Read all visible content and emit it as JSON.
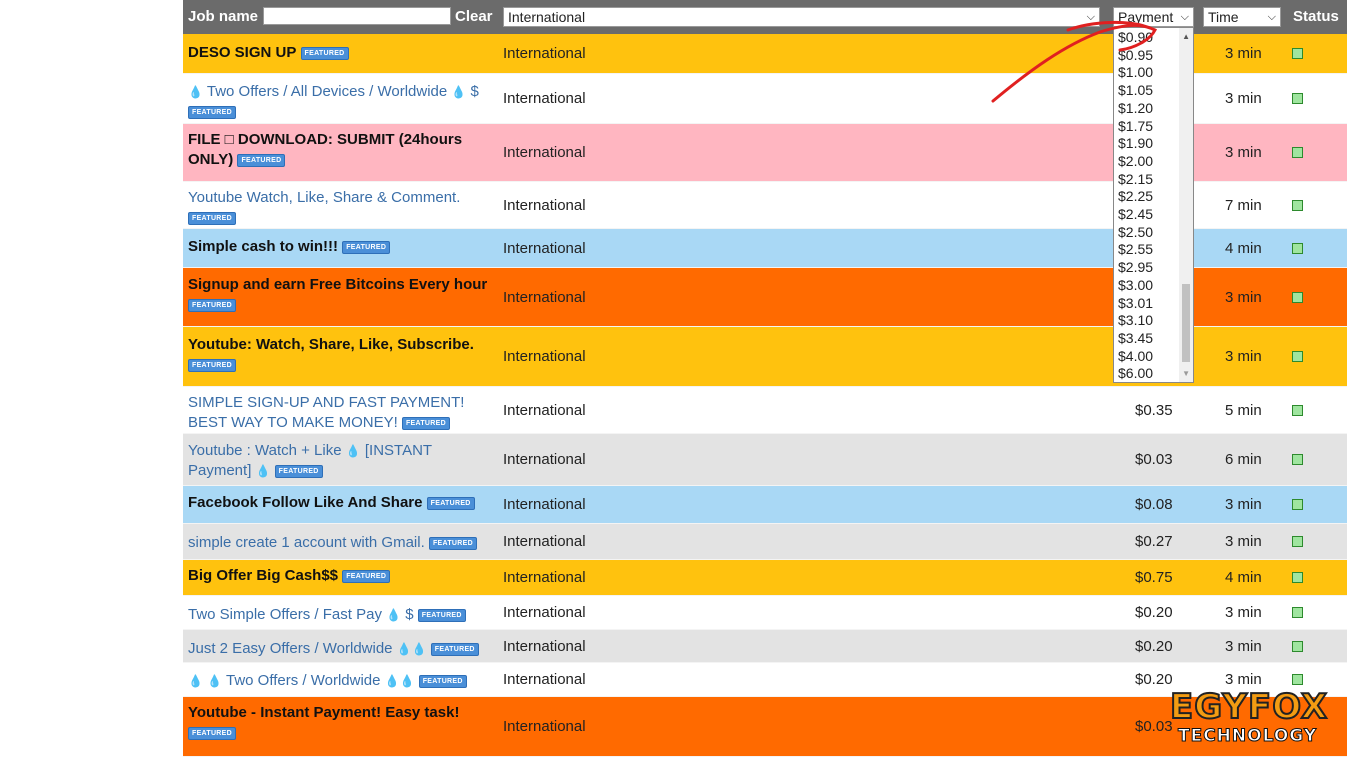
{
  "header": {
    "job_name_label": "Job name",
    "clear_label": "Clear",
    "region_select": "International",
    "payment_select": "Payment",
    "time_select": "Time",
    "status_label": "Status"
  },
  "payment_options": [
    "$0.90",
    "$0.95",
    "$1.00",
    "$1.05",
    "$1.20",
    "$1.75",
    "$1.90",
    "$2.00",
    "$2.15",
    "$2.25",
    "$2.45",
    "$2.50",
    "$2.55",
    "$2.95",
    "$3.00",
    "$3.01",
    "$3.10",
    "$3.45",
    "$4.00",
    "$6.00"
  ],
  "badge_text": "FEATURED",
  "rows": [
    {
      "name": "DESO SIGN UP",
      "region": "International",
      "payment": "",
      "time": "3 min",
      "bg": "#ffc20e"
    },
    {
      "name": "Two Offers / All Devices / Worldwide",
      "suffix": "$",
      "region": "International",
      "payment": "",
      "time": "3 min",
      "bg": "#ffffff"
    },
    {
      "name": "FILE □ DOWNLOAD: SUBMIT (24hours ONLY)",
      "region": "International",
      "payment": "",
      "time": "3 min",
      "bg": "#ffb6c1"
    },
    {
      "name": "Youtube Watch, Like, Share & Comment.",
      "region": "International",
      "payment": "",
      "time": "7 min",
      "bg": "#ffffff"
    },
    {
      "name": "Simple cash to win!!!",
      "region": "International",
      "payment": "",
      "time": "4 min",
      "bg": "#a9d8f5"
    },
    {
      "name": "Signup and earn Free Bitcoins Every hour",
      "region": "International",
      "payment": "",
      "time": "3 min",
      "bg": "#ff6a00"
    },
    {
      "name": "Youtube: Watch, Share, Like, Subscribe.",
      "region": "International",
      "payment": "",
      "time": "3 min",
      "bg": "#ffc20e"
    },
    {
      "name": "SIMPLE SIGN-UP AND FAST PAYMENT! BEST WAY TO MAKE MONEY!",
      "region": "International",
      "payment": "$0.35",
      "time": "5 min",
      "bg": "#ffffff"
    },
    {
      "name": "Youtube : Watch + Like",
      "name2": "[INSTANT Payment]",
      "region": "International",
      "payment": "$0.03",
      "time": "6 min",
      "bg": "#e3e3e3"
    },
    {
      "name": "Facebook Follow Like And Share",
      "region": "International",
      "payment": "$0.08",
      "time": "3 min",
      "bg": "#a9d8f5"
    },
    {
      "name": "simple create 1 account with Gmail.",
      "region": "International",
      "payment": "$0.27",
      "time": "3 min",
      "bg": "#e3e3e3"
    },
    {
      "name": "Big Offer Big Cash$$",
      "region": "International",
      "payment": "$0.75",
      "time": "4 min",
      "bg": "#ffc20e"
    },
    {
      "name": "Two Simple Offers / Fast Pay",
      "suffix": "$",
      "region": "International",
      "payment": "$0.20",
      "time": "3 min",
      "bg": "#ffffff"
    },
    {
      "name": "Just 2 Easy Offers / Worldwide",
      "region": "International",
      "payment": "$0.20",
      "time": "3 min",
      "bg": "#e3e3e3"
    },
    {
      "name": "Two Offers / Worldwide",
      "region": "International",
      "payment": "$0.20",
      "time": "3 min",
      "bg": "#ffffff"
    },
    {
      "name": "Youtube - Instant Payment! Easy task!",
      "region": "International",
      "payment": "$0.03",
      "time": "",
      "bg": "#ff6a00"
    }
  ],
  "logo": {
    "main": "EGYFOX",
    "sub": "TECHNOLOGY"
  }
}
